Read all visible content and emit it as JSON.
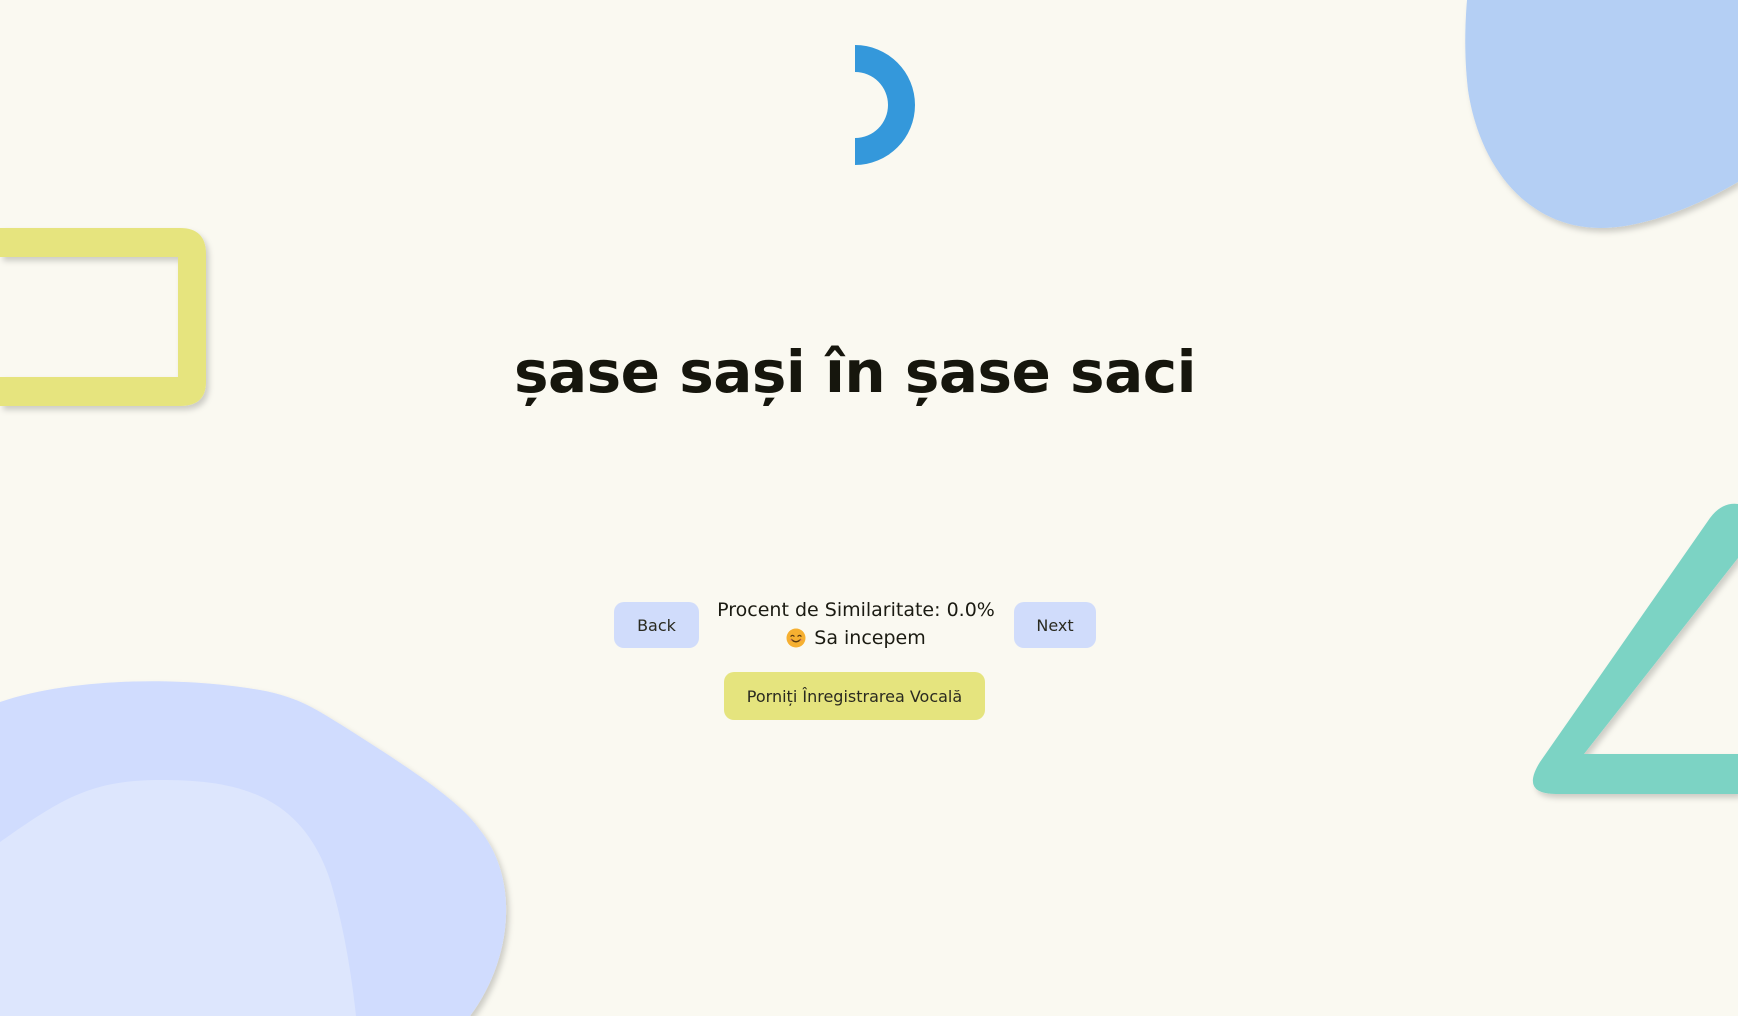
{
  "colors": {
    "background": "#faf9f1",
    "logo_blue": "#3498db",
    "button_blue": "#d0dcfb",
    "record_yellow": "#e5e47e",
    "deco_yellow": "#e6e47e",
    "deco_teal": "#7bd3c4",
    "deco_blue_top": "#b4cff4",
    "deco_blue_bottom": "#d0dcfe",
    "deco_blue_bottom_light": "#dde6fd"
  },
  "logo": {
    "icon": "half-ring-logo-icon"
  },
  "headline": {
    "text": "șase sași în șase saci"
  },
  "navigation": {
    "back_label": "Back",
    "next_label": "Next"
  },
  "status": {
    "similarity_text": "Procent de Similaritate: 0.0%",
    "mood_icon": "smiling-face-emoji-icon",
    "mood_text": "Sa incepem"
  },
  "record": {
    "label": "Porniți Înregistrarea Vocală"
  }
}
